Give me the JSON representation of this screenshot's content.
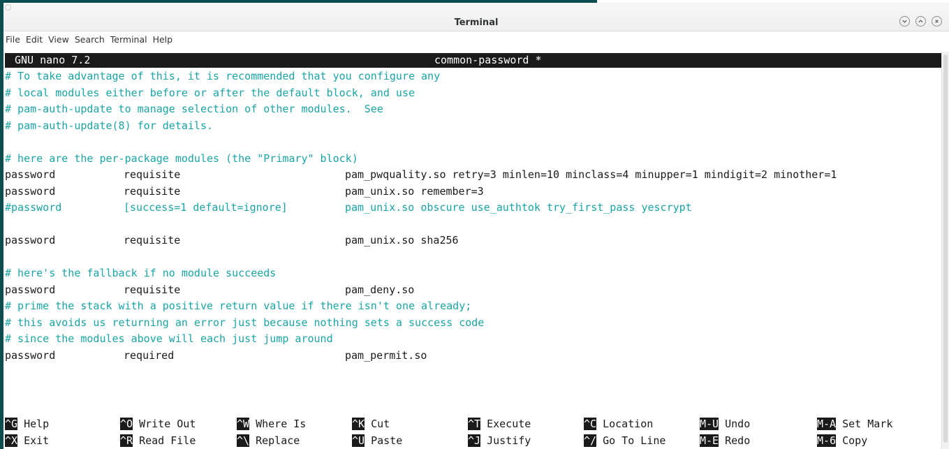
{
  "window": {
    "title": "Terminal",
    "controls": [
      {
        "name": "minimize-button",
        "icon": "chevron-down-icon"
      },
      {
        "name": "maximize-button",
        "icon": "chevron-up-icon"
      },
      {
        "name": "close-button",
        "icon": "close-icon"
      }
    ]
  },
  "menubar": {
    "items": [
      "File",
      "Edit",
      "View",
      "Search",
      "Terminal",
      "Help"
    ]
  },
  "nano": {
    "version": "GNU nano 7.2",
    "filename": "common-password *"
  },
  "lines": [
    {
      "type": "comment",
      "text": "# To take advantage of this, it is recommended that you configure any"
    },
    {
      "type": "comment",
      "text": "# local modules either before or after the default block, and use"
    },
    {
      "type": "comment",
      "text": "# pam-auth-update to manage selection of other modules.  See"
    },
    {
      "type": "comment",
      "text": "# pam-auth-update(8) for details."
    },
    {
      "type": "blank",
      "text": ""
    },
    {
      "type": "comment",
      "text": "# here are the per-package modules (the \"Primary\" block)"
    },
    {
      "type": "rule",
      "c1": "password",
      "c2": "requisite",
      "c3": "pam_pwquality.so retry=3 minlen=10 minclass=4 minupper=1 mindigit=2 minother=1"
    },
    {
      "type": "rule",
      "c1": "password",
      "c2": "requisite",
      "c3": "pam_unix.so remember=3"
    },
    {
      "type": "rule-comment",
      "c1": "#password",
      "c2": "[success=1 default=ignore]",
      "c3": "pam_unix.so obscure use_authtok try_first_pass yescrypt"
    },
    {
      "type": "blank",
      "text": ""
    },
    {
      "type": "rule",
      "c1": "password",
      "c2": "requisite",
      "c3": "pam_unix.so sha256"
    },
    {
      "type": "blank",
      "text": ""
    },
    {
      "type": "comment",
      "text": "# here's the fallback if no module succeeds"
    },
    {
      "type": "rule",
      "c1": "password",
      "c2": "requisite",
      "c3": "pam_deny.so"
    },
    {
      "type": "comment",
      "text": "# prime the stack with a positive return value if there isn't one already;"
    },
    {
      "type": "comment",
      "text": "# this avoids us returning an error just because nothing sets a success code"
    },
    {
      "type": "comment",
      "text": "# since the modules above will each just jump around"
    },
    {
      "type": "rule",
      "c1": "password",
      "c2": "required",
      "c3": "pam_permit.so"
    }
  ],
  "shortcuts": {
    "row1": [
      {
        "key": "^G",
        "label": "Help"
      },
      {
        "key": "^O",
        "label": "Write Out"
      },
      {
        "key": "^W",
        "label": "Where Is"
      },
      {
        "key": "^K",
        "label": "Cut"
      },
      {
        "key": "^T",
        "label": "Execute"
      },
      {
        "key": "^C",
        "label": "Location"
      },
      {
        "key": "M-U",
        "label": "Undo"
      },
      {
        "key": "M-A",
        "label": "Set Mark"
      }
    ],
    "row2": [
      {
        "key": "^X",
        "label": "Exit"
      },
      {
        "key": "^R",
        "label": "Read File"
      },
      {
        "key": "^\\",
        "label": "Replace"
      },
      {
        "key": "^U",
        "label": "Paste"
      },
      {
        "key": "^J",
        "label": "Justify"
      },
      {
        "key": "^/",
        "label": "Go To Line"
      },
      {
        "key": "M-E",
        "label": "Redo"
      },
      {
        "key": "M-6",
        "label": "Copy"
      }
    ]
  },
  "colors": {
    "comment": "#1aa4a6",
    "text": "#1a1a1a",
    "header_bg": "#1a1a1a",
    "accent": "#0e4d4f"
  }
}
